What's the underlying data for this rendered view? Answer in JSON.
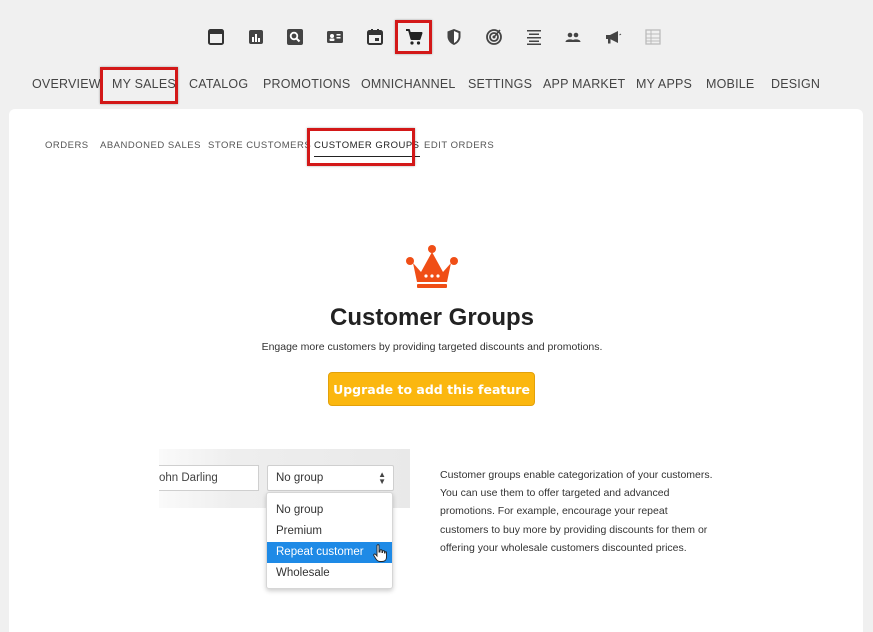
{
  "toolbar": {
    "icons": [
      {
        "name": "website-icon"
      },
      {
        "name": "analytics-icon"
      },
      {
        "name": "search-icon"
      },
      {
        "name": "contacts-icon"
      },
      {
        "name": "calendar-icon"
      },
      {
        "name": "cart-icon"
      },
      {
        "name": "security-icon"
      },
      {
        "name": "target-icon"
      },
      {
        "name": "align-icon"
      },
      {
        "name": "people-icon"
      },
      {
        "name": "megaphone-icon"
      },
      {
        "name": "grid-icon"
      }
    ]
  },
  "main_nav": {
    "items": [
      "OVERVIEW",
      "MY SALES",
      "CATALOG",
      "PROMOTIONS",
      "OMNICHANNEL",
      "SETTINGS",
      "APP MARKET",
      "MY APPS",
      "MOBILE",
      "DESIGN"
    ],
    "active": "MY SALES"
  },
  "sub_nav": {
    "items": [
      "ORDERS",
      "ABANDONED SALES",
      "STORE CUSTOMERS",
      "CUSTOMER GROUPS",
      "EDIT ORDERS"
    ],
    "active": "CUSTOMER GROUPS"
  },
  "feature": {
    "title": "Customer Groups",
    "subtitle": "Engage more customers by providing targeted discounts and promotions.",
    "upgrade_label": "Upgrade to add this feature"
  },
  "illustration": {
    "name_value": "ohn Darling",
    "select_value": "No group",
    "options": [
      "No group",
      "Premium",
      "Repeat customer",
      "Wholesale"
    ],
    "selected_option": "Repeat customer"
  },
  "description": "Customer groups enable categorization of your customers. You can use them to offer targeted and advanced promotions. For example, encourage your repeat customers to buy more by providing discounts for them or offering your wholesale customers discounted prices.",
  "colors": {
    "highlight": "#d31818",
    "crown": "#f04e16",
    "upgrade_button": "#fbb70f",
    "selected_option": "#1e8ae6"
  }
}
